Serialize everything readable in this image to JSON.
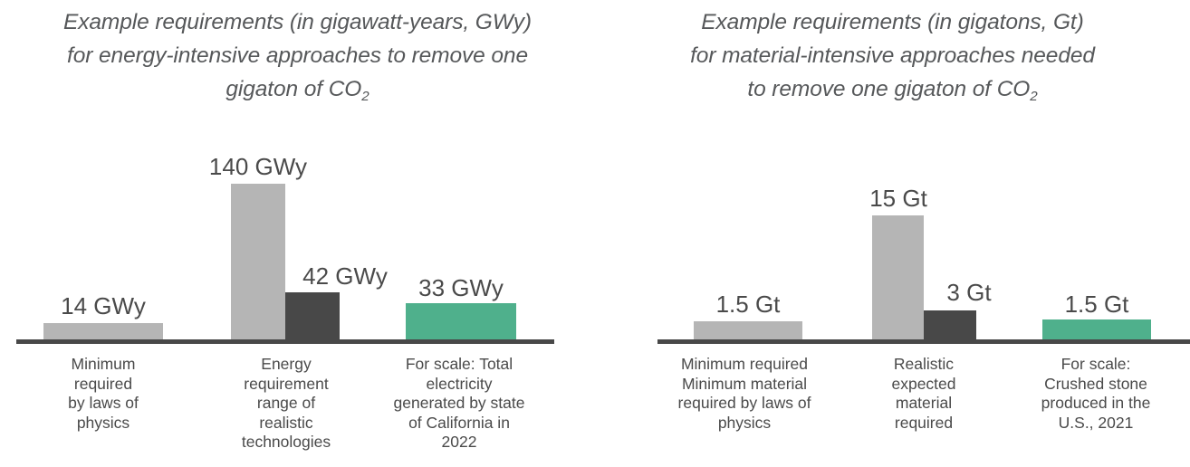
{
  "panels": [
    {
      "id": "energy",
      "title_lines": [
        "Example requirements (in gigawatt-years, GWy)",
        "for energy-intensive approaches to remove one",
        "gigaton of CO"
      ],
      "title_sub": "2",
      "categories": [
        "Minimum\nrequired\nby laws of\nphysics",
        "Energy\nrequirement\nrange of\nrealistic\ntechnologies",
        "For scale: Total\nelectricity\ngenerated by state\nof California in\n2022"
      ],
      "bars": [
        {
          "label": "14 GWy",
          "value": 14,
          "color": "#b5b5b5"
        },
        {
          "label": "140 GWy",
          "value": 140,
          "color": "#b5b5b5"
        },
        {
          "label": "42 GWy",
          "value": 42,
          "color": "#484848"
        },
        {
          "label": "33 GWy",
          "value": 33,
          "color": "#4fb08c"
        }
      ]
    },
    {
      "id": "material",
      "title_lines": [
        "Example requirements (in gigatons, Gt)",
        "for material-intensive approaches needed",
        "to remove one gigaton of CO"
      ],
      "title_sub": "2",
      "categories": [
        "Minimum required\nMinimum material\nrequired by laws of\nphysics",
        "Realistic\nexpected\nmaterial\nrequired",
        "For scale:\nCrushed stone\nproduced in the\nU.S., 2021"
      ],
      "bars": [
        {
          "label": "1.5 Gt",
          "value": 1.5,
          "color": "#b5b5b5"
        },
        {
          "label": "15 Gt",
          "value": 15,
          "color": "#b5b5b5"
        },
        {
          "label": "3 Gt",
          "value": 3,
          "color": "#484848"
        },
        {
          "label": "1.5 Gt",
          "value": 1.5,
          "color": "#4fb08c"
        }
      ]
    }
  ],
  "chart_data": [
    {
      "type": "bar",
      "title": "Example requirements (in gigawatt-years, GWy) for energy-intensive approaches to remove one gigaton of CO2",
      "categories": [
        "Minimum required by laws of physics",
        "Energy requirement range of realistic technologies",
        "For scale: Total electricity generated by state of California in 2022"
      ],
      "bars": [
        {
          "category": "Minimum required by laws of physics",
          "label": "14 GWy",
          "value": 14,
          "unit": "GWy",
          "color": "#b5b5b5"
        },
        {
          "category": "Energy requirement range of realistic technologies",
          "label": "140 GWy",
          "value": 140,
          "unit": "GWy",
          "color": "#b5b5b5"
        },
        {
          "category": "Energy requirement range of realistic technologies",
          "label": "42 GWy",
          "value": 42,
          "unit": "GWy",
          "color": "#484848"
        },
        {
          "category": "For scale: Total electricity generated by state of California in 2022",
          "label": "33 GWy",
          "value": 33,
          "unit": "GWy",
          "color": "#4fb08c"
        }
      ],
      "xlabel": "",
      "ylabel": "",
      "ylim": [
        0,
        140
      ],
      "grid": false,
      "legend": "none"
    },
    {
      "type": "bar",
      "title": "Example requirements (in gigatons, Gt) for material-intensive approaches needed to remove one gigaton of CO2",
      "categories": [
        "Minimum required Minimum material required by laws of physics",
        "Realistic expected material required",
        "For scale: Crushed stone produced in the U.S., 2021"
      ],
      "bars": [
        {
          "category": "Minimum required Minimum material required by laws of physics",
          "label": "1.5 Gt",
          "value": 1.5,
          "unit": "Gt",
          "color": "#b5b5b5"
        },
        {
          "category": "Realistic expected material required",
          "label": "15 Gt",
          "value": 15,
          "unit": "Gt",
          "color": "#b5b5b5"
        },
        {
          "category": "Realistic expected material required",
          "label": "3 Gt",
          "value": 3,
          "unit": "Gt",
          "color": "#484848"
        },
        {
          "category": "For scale: Crushed stone produced in the U.S., 2021",
          "label": "1.5 Gt",
          "value": 1.5,
          "unit": "Gt",
          "color": "#4fb08c"
        }
      ],
      "xlabel": "",
      "ylabel": "",
      "ylim": [
        0,
        15
      ],
      "grid": false,
      "legend": "none"
    }
  ]
}
